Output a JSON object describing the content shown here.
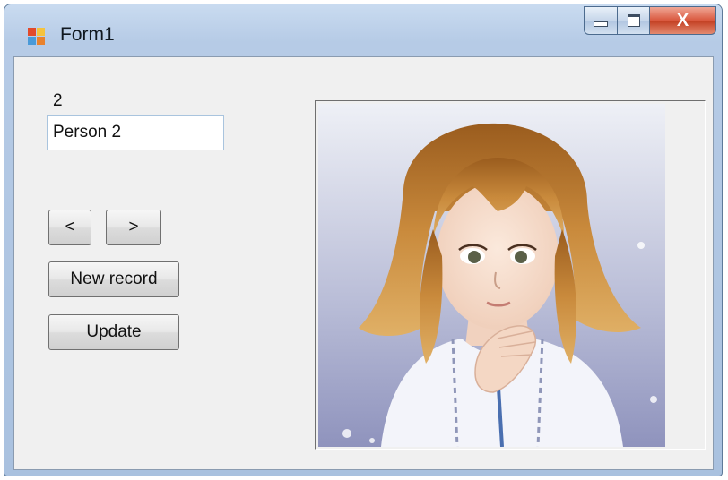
{
  "window": {
    "title": "Form1",
    "controls": {
      "minimize": "minimize",
      "maximize": "maximize",
      "close": "X"
    }
  },
  "form": {
    "id_value": "2",
    "name_value": "Person 2",
    "buttons": {
      "prev": "<",
      "next": ">",
      "new_record": "New record",
      "update": "Update"
    }
  },
  "picture": {
    "subject": "portrait-illustration-girl"
  },
  "colors": {
    "client_bg": "#f0f0f0",
    "titlebar": "#b6cbe6",
    "close_button": "#c94527"
  }
}
